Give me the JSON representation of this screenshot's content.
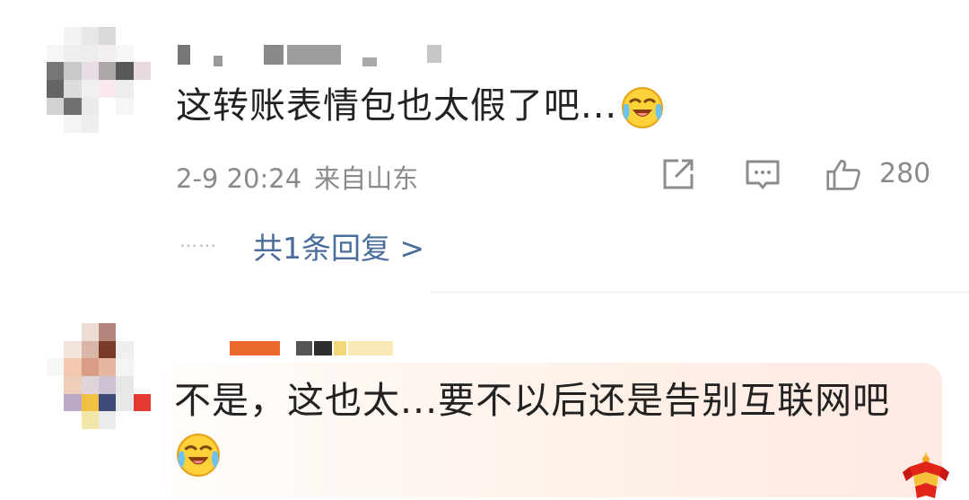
{
  "comments": [
    {
      "text": "这转账表情包也太假了吧...",
      "emoji": "laughing-crying-emoji",
      "date": "2-9 20:24",
      "location": "来自山东",
      "likes": "280",
      "replies_dots": "……",
      "replies_label": "共1条回复 >"
    },
    {
      "text": "不是，这也太...要不以后还是告别互联网吧",
      "emoji": "laughing-crying-emoji"
    }
  ],
  "icons": {
    "share": "share-icon",
    "reply": "comment-icon",
    "like": "thumbs-up-icon",
    "badge": "firecracker-badge-icon"
  },
  "colors": {
    "link": "#4a6d9c",
    "meta": "#8a8a8a",
    "text": "#222222"
  }
}
